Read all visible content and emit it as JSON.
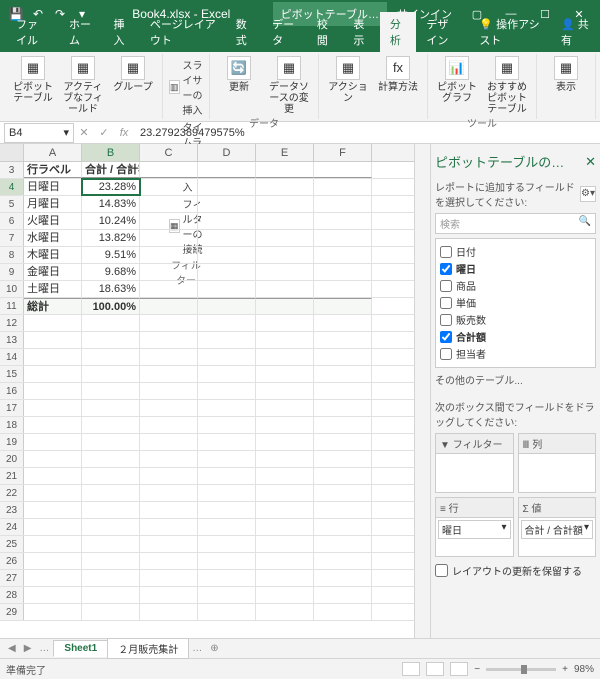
{
  "title": "Book4.xlsx - Excel",
  "contextTab": "ピボットテーブル…",
  "signin": "サインイン",
  "ribbonTabs": [
    "ファイル",
    "ホーム",
    "挿入",
    "ページレイアウト",
    "数式",
    "データ",
    "校閲",
    "表示",
    "分析",
    "デザイン"
  ],
  "activeTab": "分析",
  "tellMe": "操作アシスト",
  "share": "共有",
  "ribbon": {
    "g1": {
      "btn1": "ピボットテーブル",
      "btn2": "アクティブなフィールド",
      "btn3": "グループ"
    },
    "g2": {
      "s1": "スライサーの挿入",
      "s2": "タイムラインの挿入",
      "s3": "フィルターの接続",
      "label": "フィルター"
    },
    "g3": {
      "btn1": "更新",
      "btn2": "データソースの変更",
      "label": "データ"
    },
    "g4": {
      "btn1": "アクション",
      "btn2": "計算方法"
    },
    "g5": {
      "btn1": "ピボットグラフ",
      "btn2": "おすすめピボットテーブル",
      "label": "ツール"
    },
    "g6": {
      "btn1": "表示"
    }
  },
  "nameBox": "B4",
  "formula": "23.2792389479575%",
  "cols": [
    "A",
    "B",
    "C",
    "D",
    "E",
    "F"
  ],
  "headerRow": {
    "num": 3,
    "a": "行ラベル",
    "b": "合計 / 合計額"
  },
  "dataRows": [
    {
      "num": 4,
      "a": "日曜日",
      "b": "23.28%",
      "sel": true
    },
    {
      "num": 5,
      "a": "月曜日",
      "b": "14.83%"
    },
    {
      "num": 6,
      "a": "火曜日",
      "b": "10.24%"
    },
    {
      "num": 7,
      "a": "水曜日",
      "b": "13.82%"
    },
    {
      "num": 8,
      "a": "木曜日",
      "b": "9.51%"
    },
    {
      "num": 9,
      "a": "金曜日",
      "b": "9.68%"
    },
    {
      "num": 10,
      "a": "土曜日",
      "b": "18.63%"
    }
  ],
  "totalRow": {
    "num": 11,
    "a": "総計",
    "b": "100.00%"
  },
  "emptyRows": [
    12,
    13,
    14,
    15,
    16,
    17,
    18,
    19,
    20,
    21,
    22,
    23,
    24,
    25,
    26,
    27,
    28,
    29
  ],
  "taskpane": {
    "title": "ピボットテーブルの…",
    "sub": "レポートに追加するフィールドを選択してください:",
    "searchPlaceholder": "検索",
    "fields": [
      {
        "label": "日付",
        "checked": false
      },
      {
        "label": "曜日",
        "checked": true
      },
      {
        "label": "商品",
        "checked": false
      },
      {
        "label": "単価",
        "checked": false
      },
      {
        "label": "販売数",
        "checked": false
      },
      {
        "label": "合計額",
        "checked": true
      },
      {
        "label": "担当者",
        "checked": false
      }
    ],
    "moreTables": "その他のテーブル...",
    "areasLabel": "次のボックス間でフィールドをドラッグしてください:",
    "areas": {
      "filter": "フィルター",
      "cols": "列",
      "rows": "行",
      "vals": "値",
      "rowItem": "曜日",
      "valItem": "合計 / 合計額"
    },
    "defer": "レイアウトの更新を保留する"
  },
  "sheets": {
    "active": "Sheet1",
    "other": "２月販売集計"
  },
  "status": {
    "ready": "準備完了",
    "zoom": "98%"
  }
}
